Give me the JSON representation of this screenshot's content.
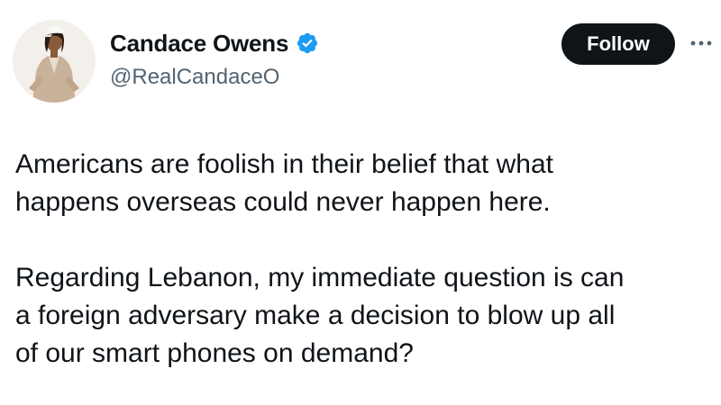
{
  "author": {
    "display_name": "Candace Owens",
    "handle": "@RealCandaceO",
    "verified": true
  },
  "actions": {
    "follow_label": "Follow",
    "more_icon": "more-horizontal-icon"
  },
  "icons": {
    "verified": "verified-badge-icon",
    "avatar": "profile-photo"
  },
  "colors": {
    "text": "#0f1419",
    "secondary_text": "#536471",
    "verified_blue": "#1d9bf0",
    "follow_button_bg": "#0f1419",
    "follow_button_text": "#ffffff"
  },
  "tweet": {
    "paragraphs": [
      "Americans are foolish in their belief that what\nhappens overseas could never happen here.",
      "Regarding Lebanon, my immediate question is can\na foreign adversary make a decision to blow up all\nof our smart phones on demand?"
    ]
  }
}
